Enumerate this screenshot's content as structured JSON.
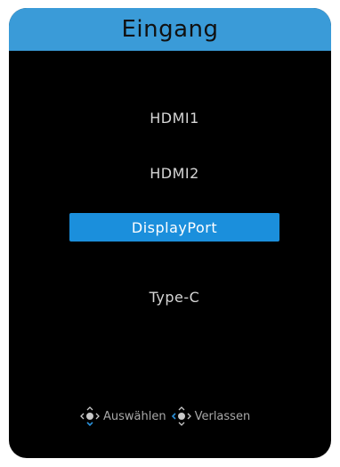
{
  "header": {
    "title": "Eingang"
  },
  "menu": {
    "items": [
      {
        "label": "HDMI1",
        "selected": false
      },
      {
        "label": "HDMI2",
        "selected": false
      },
      {
        "label": "DisplayPort",
        "selected": true
      },
      {
        "label": "Type-C",
        "selected": false
      }
    ]
  },
  "footer": {
    "select_icon": "joystick-icon",
    "select_label": "Auswählen",
    "exit_icon": "joystick-icon",
    "exit_label": "Verlassen"
  },
  "colors": {
    "header_bg": "#3a9bd8",
    "selected_bg": "#1b8fdc",
    "panel_bg": "#000000",
    "icon_accent": "#2a8fd8"
  }
}
